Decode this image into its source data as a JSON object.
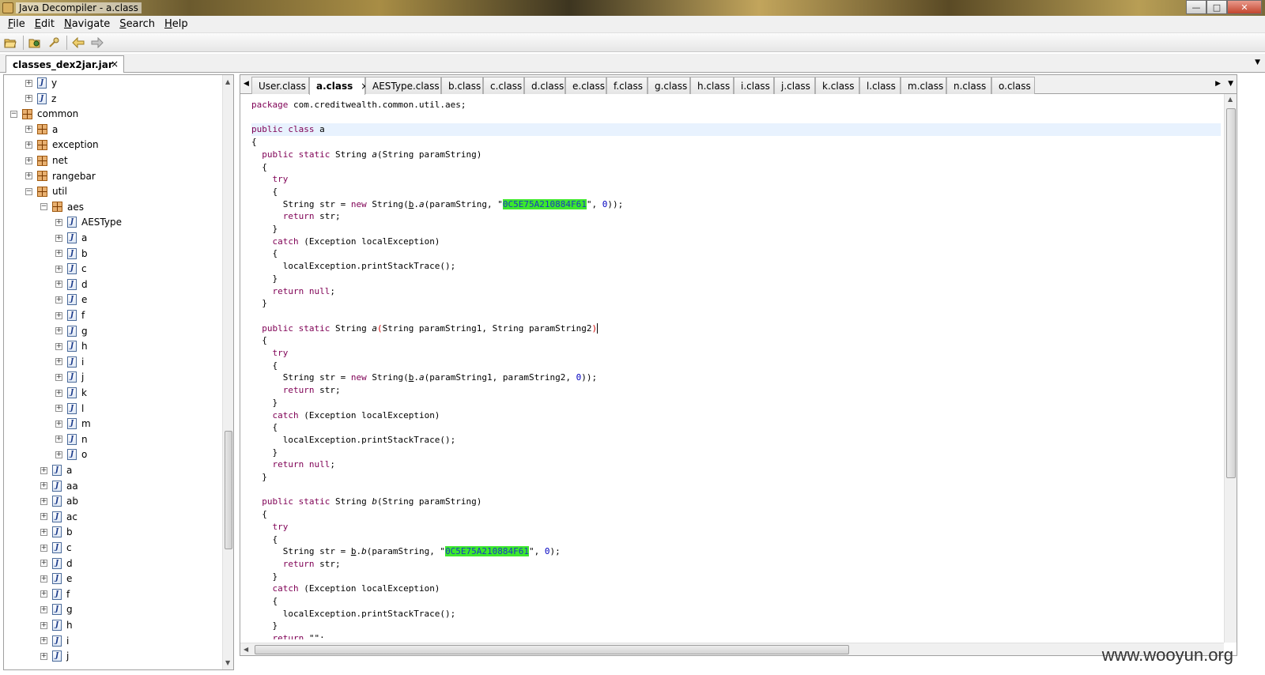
{
  "window": {
    "title": "Java Decompiler - a.class",
    "buttons": [
      "minimize",
      "maximize",
      "close"
    ]
  },
  "menu": [
    {
      "label": "File",
      "mnemonic": "F"
    },
    {
      "label": "Edit",
      "mnemonic": "E"
    },
    {
      "label": "Navigate",
      "mnemonic": "N"
    },
    {
      "label": "Search",
      "mnemonic": "S"
    },
    {
      "label": "Help",
      "mnemonic": "H"
    }
  ],
  "toolbar": [
    "open-file-icon",
    "open-type-icon",
    "search-icon",
    "back-icon",
    "forward-icon"
  ],
  "file_tab": {
    "label": "classes_dex2jar.jar",
    "close": "×"
  },
  "tree": {
    "items": [
      {
        "label": "y",
        "type": "class",
        "depth": 3
      },
      {
        "label": "z",
        "type": "class",
        "depth": 3
      },
      {
        "label": "common",
        "type": "package",
        "depth": 2,
        "expanded": true
      },
      {
        "label": "a",
        "type": "package",
        "depth": 3
      },
      {
        "label": "exception",
        "type": "package",
        "depth": 3
      },
      {
        "label": "net",
        "type": "package",
        "depth": 3
      },
      {
        "label": "rangebar",
        "type": "package",
        "depth": 3
      },
      {
        "label": "util",
        "type": "package",
        "depth": 3,
        "expanded": true
      },
      {
        "label": "aes",
        "type": "package",
        "depth": 4,
        "expanded": true
      },
      {
        "label": "AESType",
        "type": "class",
        "depth": 5
      },
      {
        "label": "a",
        "type": "class",
        "depth": 5
      },
      {
        "label": "b",
        "type": "class",
        "depth": 5
      },
      {
        "label": "c",
        "type": "class",
        "depth": 5
      },
      {
        "label": "d",
        "type": "class",
        "depth": 5
      },
      {
        "label": "e",
        "type": "class",
        "depth": 5
      },
      {
        "label": "f",
        "type": "class",
        "depth": 5
      },
      {
        "label": "g",
        "type": "class",
        "depth": 5
      },
      {
        "label": "h",
        "type": "class",
        "depth": 5
      },
      {
        "label": "i",
        "type": "class",
        "depth": 5
      },
      {
        "label": "j",
        "type": "class",
        "depth": 5
      },
      {
        "label": "k",
        "type": "class",
        "depth": 5
      },
      {
        "label": "l",
        "type": "class",
        "depth": 5
      },
      {
        "label": "m",
        "type": "class",
        "depth": 5
      },
      {
        "label": "n",
        "type": "class",
        "depth": 5
      },
      {
        "label": "o",
        "type": "class",
        "depth": 5
      },
      {
        "label": "a",
        "type": "class",
        "depth": 4
      },
      {
        "label": "aa",
        "type": "class",
        "depth": 4
      },
      {
        "label": "ab",
        "type": "class",
        "depth": 4
      },
      {
        "label": "ac",
        "type": "class",
        "depth": 4
      },
      {
        "label": "b",
        "type": "class",
        "depth": 4
      },
      {
        "label": "c",
        "type": "class",
        "depth": 4
      },
      {
        "label": "d",
        "type": "class",
        "depth": 4
      },
      {
        "label": "e",
        "type": "class",
        "depth": 4
      },
      {
        "label": "f",
        "type": "class",
        "depth": 4
      },
      {
        "label": "g",
        "type": "class",
        "depth": 4
      },
      {
        "label": "h",
        "type": "class",
        "depth": 4
      },
      {
        "label": "i",
        "type": "class",
        "depth": 4
      },
      {
        "label": "j",
        "type": "class",
        "depth": 4
      }
    ]
  },
  "class_tabs": [
    {
      "label": "User.class"
    },
    {
      "label": "a.class",
      "active": true
    },
    {
      "label": "AESType.class"
    },
    {
      "label": "b.class"
    },
    {
      "label": "c.class"
    },
    {
      "label": "d.class"
    },
    {
      "label": "e.class"
    },
    {
      "label": "f.class"
    },
    {
      "label": "g.class"
    },
    {
      "label": "h.class"
    },
    {
      "label": "i.class"
    },
    {
      "label": "j.class"
    },
    {
      "label": "k.class"
    },
    {
      "label": "l.class"
    },
    {
      "label": "m.class"
    },
    {
      "label": "n.class"
    },
    {
      "label": "o.class"
    }
  ],
  "code_lines": [
    [
      [
        "kw",
        "package"
      ],
      [
        "t",
        " com.creditwealth.common.util.aes;"
      ]
    ],
    [],
    [
      [
        "kw",
        "public class"
      ],
      [
        "t",
        " a"
      ]
    ],
    [
      [
        "t",
        "{"
      ]
    ],
    [
      [
        "t",
        "  "
      ],
      [
        "kw",
        "public static"
      ],
      [
        "t",
        " String "
      ],
      [
        "it",
        "a"
      ],
      [
        "t",
        "(String paramString)"
      ]
    ],
    [
      [
        "t",
        "  {"
      ]
    ],
    [
      [
        "t",
        "    "
      ],
      [
        "kw",
        "try"
      ]
    ],
    [
      [
        "t",
        "    {"
      ]
    ],
    [
      [
        "t",
        "      String str = "
      ],
      [
        "kw",
        "new"
      ],
      [
        "t",
        " String("
      ],
      [
        "ul",
        "b"
      ],
      [
        "t",
        "."
      ],
      [
        "it",
        "a"
      ],
      [
        "t",
        "(paramString, \""
      ],
      [
        "hlstr",
        "0C5E75A210884F61"
      ],
      [
        "t",
        "\", "
      ],
      [
        "num",
        "0"
      ],
      [
        "t",
        "));"
      ]
    ],
    [
      [
        "t",
        "      "
      ],
      [
        "kw",
        "return"
      ],
      [
        "t",
        " str;"
      ]
    ],
    [
      [
        "t",
        "    }"
      ]
    ],
    [
      [
        "t",
        "    "
      ],
      [
        "kw",
        "catch"
      ],
      [
        "t",
        " (Exception localException)"
      ]
    ],
    [
      [
        "t",
        "    {"
      ]
    ],
    [
      [
        "t",
        "      localException.printStackTrace();"
      ]
    ],
    [
      [
        "t",
        "    }"
      ]
    ],
    [
      [
        "t",
        "    "
      ],
      [
        "kw",
        "return null"
      ],
      [
        "t",
        ";"
      ]
    ],
    [
      [
        "t",
        "  }"
      ]
    ],
    [],
    [
      [
        "t",
        "  "
      ],
      [
        "kw",
        "public static"
      ],
      [
        "t",
        " String "
      ],
      [
        "it",
        "a"
      ],
      [
        "paren",
        "("
      ],
      [
        "t",
        "String paramString1, String paramString2"
      ],
      [
        "paren",
        ")"
      ],
      [
        "caret",
        ""
      ]
    ],
    [
      [
        "t",
        "  {"
      ]
    ],
    [
      [
        "t",
        "    "
      ],
      [
        "kw",
        "try"
      ]
    ],
    [
      [
        "t",
        "    {"
      ]
    ],
    [
      [
        "t",
        "      String str = "
      ],
      [
        "kw",
        "new"
      ],
      [
        "t",
        " String("
      ],
      [
        "ul",
        "b"
      ],
      [
        "t",
        "."
      ],
      [
        "it",
        "a"
      ],
      [
        "t",
        "(paramString1, paramString2, "
      ],
      [
        "num",
        "0"
      ],
      [
        "t",
        "));"
      ]
    ],
    [
      [
        "t",
        "      "
      ],
      [
        "kw",
        "return"
      ],
      [
        "t",
        " str;"
      ]
    ],
    [
      [
        "t",
        "    }"
      ]
    ],
    [
      [
        "t",
        "    "
      ],
      [
        "kw",
        "catch"
      ],
      [
        "t",
        " (Exception localException)"
      ]
    ],
    [
      [
        "t",
        "    {"
      ]
    ],
    [
      [
        "t",
        "      localException.printStackTrace();"
      ]
    ],
    [
      [
        "t",
        "    }"
      ]
    ],
    [
      [
        "t",
        "    "
      ],
      [
        "kw",
        "return null"
      ],
      [
        "t",
        ";"
      ]
    ],
    [
      [
        "t",
        "  }"
      ]
    ],
    [],
    [
      [
        "t",
        "  "
      ],
      [
        "kw",
        "public static"
      ],
      [
        "t",
        " String "
      ],
      [
        "it",
        "b"
      ],
      [
        "t",
        "(String paramString)"
      ]
    ],
    [
      [
        "t",
        "  {"
      ]
    ],
    [
      [
        "t",
        "    "
      ],
      [
        "kw",
        "try"
      ]
    ],
    [
      [
        "t",
        "    {"
      ]
    ],
    [
      [
        "t",
        "      String str = "
      ],
      [
        "ul",
        "b"
      ],
      [
        "t",
        "."
      ],
      [
        "it",
        "b"
      ],
      [
        "t",
        "(paramString, \""
      ],
      [
        "hlstr",
        "0C5E75A210884F61"
      ],
      [
        "t",
        "\", "
      ],
      [
        "num",
        "0"
      ],
      [
        "t",
        ");"
      ]
    ],
    [
      [
        "t",
        "      "
      ],
      [
        "kw",
        "return"
      ],
      [
        "t",
        " str;"
      ]
    ],
    [
      [
        "t",
        "    }"
      ]
    ],
    [
      [
        "t",
        "    "
      ],
      [
        "kw",
        "catch"
      ],
      [
        "t",
        " (Exception localException)"
      ]
    ],
    [
      [
        "t",
        "    {"
      ]
    ],
    [
      [
        "t",
        "      localException.printStackTrace();"
      ]
    ],
    [
      [
        "t",
        "    }"
      ]
    ],
    [
      [
        "t",
        "    "
      ],
      [
        "kw",
        "return"
      ],
      [
        "t",
        " \"\";"
      ]
    ]
  ],
  "highlighted_line": 2,
  "watermark": "www.wooyun.org",
  "colors": {
    "keyword": "#7f0055",
    "number": "#0000c0",
    "string_highlight": "#3de82c",
    "current_line": "#e8f2fe"
  }
}
